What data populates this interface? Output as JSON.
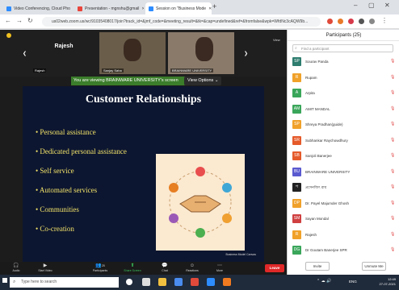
{
  "browser": {
    "tabs": [
      {
        "label": "Video Conferencing, Cloud Pho",
        "color": "#2d8cff"
      },
      {
        "label": "Presentation - mgnshu@gmail",
        "color": "#e8453c"
      },
      {
        "label": "Session on \"Business Mode",
        "color": "#2d8cff"
      }
    ],
    "new_tab": "+",
    "url": "us02web.zoom.us/wc/91035408017/join?track_id=&jmf_code=&meeting_result=&tk=&cap=undefined&ref=&fromfalse&wpk=WfdNc3cAQW9b..."
  },
  "meeting": {
    "presenter_name": "Rajesh",
    "tiles": [
      {
        "name": "Rajesh"
      },
      {
        "name": "Sanjay Saha"
      },
      {
        "name": "BRAINWARE UNIVERSITY"
      }
    ],
    "view_label": "View",
    "banner": "You are viewing BRAINWARE UNIVERSITY's screen",
    "view_options": "View Options ⌄",
    "slide": {
      "title": "Customer Relationships",
      "bullets": [
        "Personal assistance",
        "Dedicated personal assistance",
        "Self service",
        "Automated services",
        "Communities",
        "Co-creation"
      ],
      "credit": "Business Model Canvas"
    },
    "toolbar": [
      {
        "icon": "🎧",
        "label": "Audio"
      },
      {
        "icon": "▶",
        "label": "Start Video"
      },
      {
        "icon": "👥",
        "label": "Participants",
        "count": "25"
      },
      {
        "icon": "⬆",
        "label": "Share Screen"
      },
      {
        "icon": "💬",
        "label": "Chat"
      },
      {
        "icon": "☺",
        "label": "Reactions"
      },
      {
        "icon": "⋯",
        "label": "More"
      }
    ],
    "leave": "Leave"
  },
  "participants": {
    "title": "Participants (25)",
    "search_placeholder": "Find a participant",
    "list": [
      {
        "initials": "SP",
        "name": "Sourav Panda",
        "color": "#2e7d6f"
      },
      {
        "initials": "R",
        "name": "Rupam",
        "color": "#f0a12a"
      },
      {
        "initials": "A",
        "name": "Arpita",
        "color": "#3aa65a"
      },
      {
        "initials": "AM",
        "name": "AMIT MANDAL",
        "color": "#3aa65a"
      },
      {
        "initials": "SP",
        "name": "Shreya Pradhan(guide)",
        "color": "#f0a12a"
      },
      {
        "initials": "SR",
        "name": "Subhankar Raychowdhury",
        "color": "#e55a2a"
      },
      {
        "initials": "SB",
        "name": "Sanjoli Banerjee",
        "color": "#e55a2a"
      },
      {
        "initials": "BU",
        "name": "BRAINWARE UNIVERSITY",
        "color": "#5a5ad0"
      },
      {
        "initials": "প",
        "name": "প্রসেনজিৎ রায়",
        "color": "#222222"
      },
      {
        "initials": "DP",
        "name": "Dr. Payel Majumder Ghosh",
        "color": "#f0a12a"
      },
      {
        "initials": "SM",
        "name": "Sayan Mondal",
        "color": "#d04040"
      },
      {
        "initials": "R",
        "name": "Rajesh",
        "color": "#f0a12a"
      },
      {
        "initials": "DG",
        "name": "Dr Goutam Banerjee SPR",
        "color": "#3aa65a"
      }
    ],
    "invite": "Invite",
    "unmute_me": "Unmute Me"
  },
  "taskbar": {
    "search_placeholder": "Type here to search",
    "time": "12:49",
    "date": "27-07-2021",
    "lang": "ENG"
  }
}
